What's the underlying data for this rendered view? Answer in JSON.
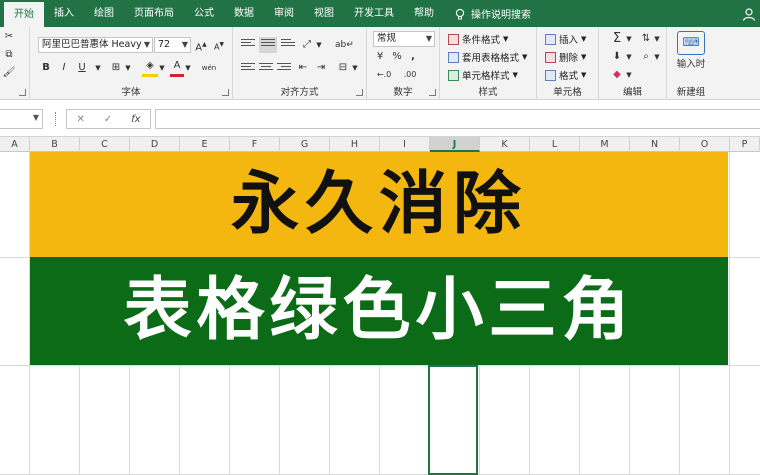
{
  "ribbon_tabs": [
    {
      "label": "开始",
      "active": true
    },
    {
      "label": "插入"
    },
    {
      "label": "绘图"
    },
    {
      "label": "页面布局"
    },
    {
      "label": "公式"
    },
    {
      "label": "数据"
    },
    {
      "label": "审阅"
    },
    {
      "label": "视图"
    },
    {
      "label": "开发工具"
    },
    {
      "label": "帮助"
    }
  ],
  "tell_me": "操作说明搜索",
  "font": {
    "name": "阿里巴巴普惠体 Heavy",
    "size": "72",
    "grow": "A",
    "shrink": "A",
    "bold": "B",
    "italic": "I",
    "underline": "U",
    "font_color": "A",
    "phonetic": "wén"
  },
  "groups": {
    "font": "字体",
    "alignment": "对齐方式",
    "number": "数字",
    "styles": "样式",
    "cells": "单元格",
    "editing": "编辑",
    "new_group": "新建组"
  },
  "number_format": "常规",
  "number_symbols": {
    "currency": "¥",
    "percent": "%",
    "comma": ",",
    "inc_dec": "←.0",
    "dec_dec": ".00"
  },
  "styles": {
    "conditional": "条件格式",
    "table": "套用表格格式",
    "cell": "单元格样式"
  },
  "cells": {
    "insert": "插入",
    "delete": "删除",
    "format": "格式"
  },
  "input_time": "输入时",
  "formula_bar": {
    "fx": "fx",
    "cancel": "✕",
    "enter": "✓"
  },
  "columns": [
    "A",
    "B",
    "C",
    "D",
    "E",
    "F",
    "G",
    "H",
    "I",
    "J",
    "K",
    "L",
    "M",
    "N",
    "O",
    "P"
  ],
  "selected_column": "J",
  "banner": {
    "line1": "永久消除",
    "line2": "表格绿色小三角"
  },
  "colors": {
    "excel_green": "#217346",
    "banner_yellow": "#f4b70f",
    "banner_green": "#0b6b17"
  }
}
